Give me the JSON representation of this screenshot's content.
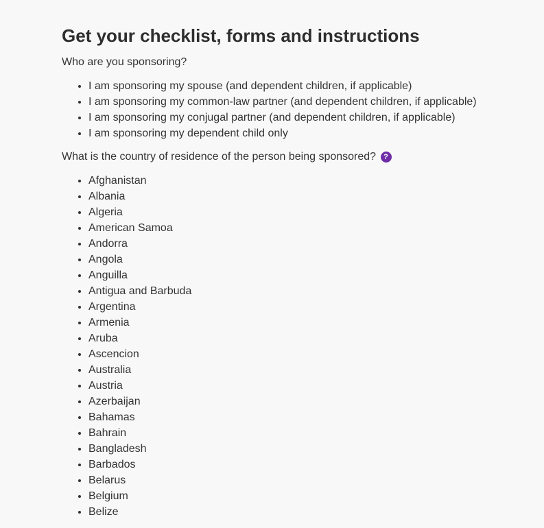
{
  "page": {
    "title": "Get your checklist, forms and instructions"
  },
  "sponsoring": {
    "question": "Who are you sponsoring?",
    "options": [
      "I am sponsoring my spouse (and dependent children, if applicable)",
      "I am sponsoring my common-law partner (and dependent children, if applicable)",
      "I am sponsoring my conjugal partner (and dependent children, if applicable)",
      "I am sponsoring my dependent child only"
    ]
  },
  "residence": {
    "question": "What is the country of residence of the person being sponsored?",
    "help_icon": "question-circle-icon",
    "help_glyph": "?",
    "help_color": "#6f2da8",
    "countries": [
      "Afghanistan",
      "Albania",
      "Algeria",
      "American Samoa",
      "Andorra",
      "Angola",
      "Anguilla",
      "Antigua and Barbuda",
      "Argentina",
      "Armenia",
      "Aruba",
      "Ascencion",
      "Australia",
      "Austria",
      "Azerbaijan",
      "Bahamas",
      "Bahrain",
      "Bangladesh",
      "Barbados",
      "Belarus",
      "Belgium",
      "Belize"
    ]
  }
}
